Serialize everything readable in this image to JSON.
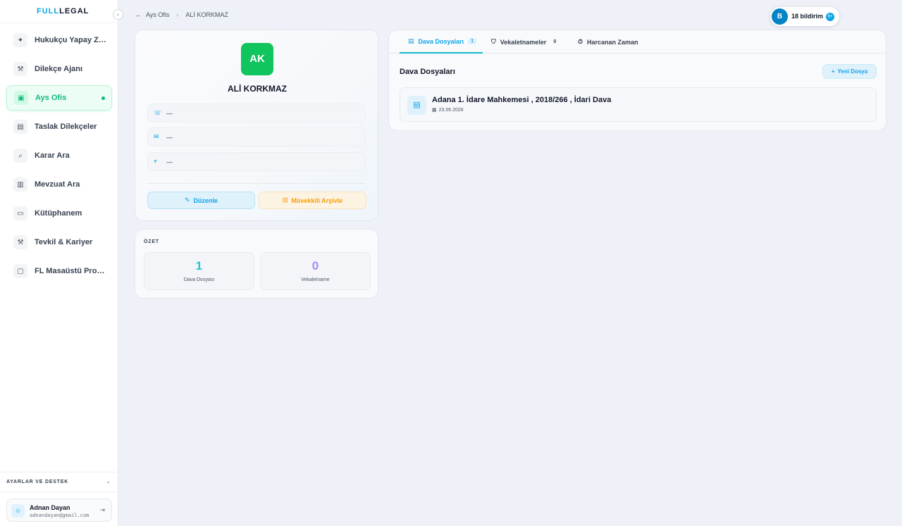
{
  "sidebar": {
    "logo_a": "FULL",
    "logo_b": "LEGAL",
    "collapse_glyph": "‹",
    "items": [
      {
        "label": "Hukukçu Yapay Zeka",
        "icon": "sparkle-icon",
        "glyph": "✦"
      },
      {
        "label": "Dilekçe Ajanı",
        "icon": "hammer-icon",
        "glyph": "⚒"
      },
      {
        "label": "Ays Ofis",
        "icon": "briefcase-icon",
        "glyph": "▣",
        "active": true
      },
      {
        "label": "Taslak Dilekçeler",
        "icon": "document-icon",
        "glyph": "▤"
      },
      {
        "label": "Karar Ara",
        "icon": "search-icon",
        "glyph": "⌕"
      },
      {
        "label": "Mevzuat Ara",
        "icon": "book-icon",
        "glyph": "▥"
      },
      {
        "label": "Kütüphanem",
        "icon": "folder-icon",
        "glyph": "▭"
      },
      {
        "label": "Tevkil & Kariyer",
        "icon": "gavel-icon",
        "glyph": "⚒"
      },
      {
        "label": "FL Masaüstü Programı",
        "icon": "desktop-icon",
        "glyph": "▢"
      }
    ],
    "settings_label": "AYARLAR VE DESTEK",
    "settings_chevron": "⌄",
    "user": {
      "name": "Adnan Dayan",
      "email": "adnandayan@gmail.com",
      "avatar_glyph": "☺",
      "logout_glyph": "⇥"
    }
  },
  "breadcrumb": {
    "back_glyph": "←",
    "parent": "Ays Ofis",
    "separator": "›",
    "current": "ALİ KORKMAZ"
  },
  "notifications": {
    "avatar_letter": "B",
    "label": "18 bildirim",
    "badge": "9+"
  },
  "profile": {
    "initials": "AK",
    "name": "ALİ KORKMAZ",
    "phone": "—",
    "email": "—",
    "address": "—",
    "phone_glyph": "☏",
    "email_glyph": "✉",
    "address_glyph": "⌖",
    "edit_label": "Düzenle",
    "edit_glyph": "✎",
    "archive_label": "Müvekkili Arşivle",
    "archive_glyph": "⊟"
  },
  "summary": {
    "title": "ÖZET",
    "stats": [
      {
        "value": "1",
        "label": "Dava Dosyası",
        "color": "#22c5d6"
      },
      {
        "value": "0",
        "label": "Vekaletname",
        "color": "#a78bfa"
      }
    ]
  },
  "files": {
    "tabs": [
      {
        "label": "Dava Dosyaları",
        "count": "1",
        "glyph": "▤",
        "active": true
      },
      {
        "label": "Vekaletnameler",
        "count": "0",
        "glyph": "⛉"
      },
      {
        "label": "Harcanan Zaman",
        "count": "",
        "glyph": "⏱"
      }
    ],
    "title": "Dava Dosyaları",
    "new_label": "Yeni Dosya",
    "new_glyph": "+",
    "items": [
      {
        "title": "Adana 1. İdare Mahkemesi , 2018/266 , İdari Dava",
        "date": "23.06.2026",
        "glyph": "▤",
        "date_glyph": "▦"
      }
    ]
  },
  "colors": {
    "accent": "#0ea5e9",
    "active_green": "#10b981",
    "avatar_green": "#10c55e",
    "archive_amber": "#f59e0b"
  }
}
